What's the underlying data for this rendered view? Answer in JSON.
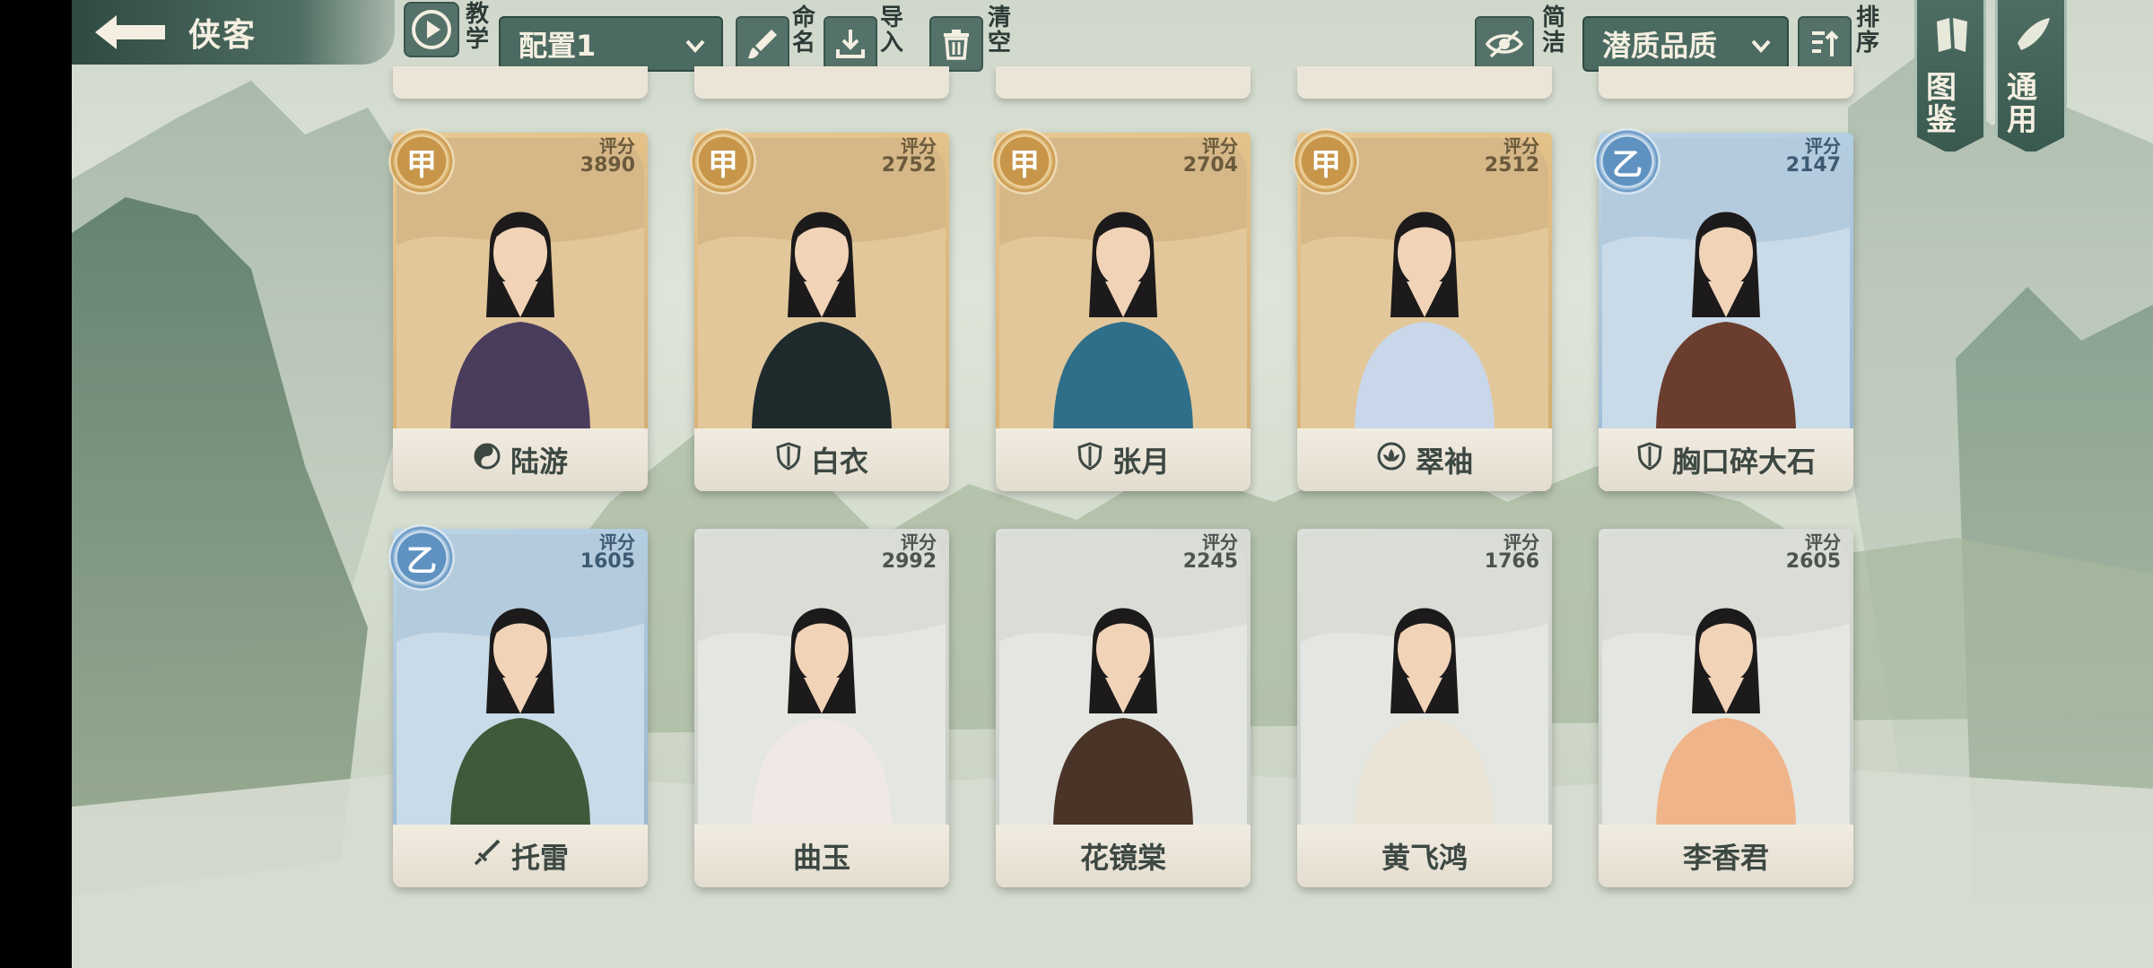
{
  "header": {
    "title": "侠客"
  },
  "toolbar": {
    "tutorial_label": "教学",
    "config_select": "配置1",
    "rename_label": "命名",
    "import_label": "导入",
    "clear_label": "清空",
    "brief_label": "简洁",
    "quality_select": "潜质品质",
    "sort_label": "排序"
  },
  "side_banners": {
    "codex": "图鉴",
    "general": "通用"
  },
  "score_label": "评分",
  "cards": [
    {
      "name": "陆游",
      "grade": "甲",
      "score": "3890",
      "tier": "jia",
      "faction_icon": "yin-yang-icon"
    },
    {
      "name": "白衣",
      "grade": "甲",
      "score": "2752",
      "tier": "jia",
      "faction_icon": "shield-icon"
    },
    {
      "name": "张月",
      "grade": "甲",
      "score": "2704",
      "tier": "jia",
      "faction_icon": "shield-icon"
    },
    {
      "name": "翠袖",
      "grade": "甲",
      "score": "2512",
      "tier": "jia",
      "faction_icon": "lotus-icon"
    },
    {
      "name": "胸口碎大石",
      "grade": "乙",
      "score": "2147",
      "tier": "yi",
      "faction_icon": "shield-icon"
    },
    {
      "name": "托雷",
      "grade": "乙",
      "score": "1605",
      "tier": "yi",
      "faction_icon": "sword-icon"
    },
    {
      "name": "曲玉",
      "grade": "",
      "score": "2992",
      "tier": "bing",
      "faction_icon": ""
    },
    {
      "name": "花镜棠",
      "grade": "",
      "score": "2245",
      "tier": "bing",
      "faction_icon": ""
    },
    {
      "name": "黄飞鸿",
      "grade": "",
      "score": "1766",
      "tier": "bing",
      "faction_icon": ""
    },
    {
      "name": "李香君",
      "grade": "",
      "score": "2605",
      "tier": "bing",
      "faction_icon": ""
    }
  ]
}
